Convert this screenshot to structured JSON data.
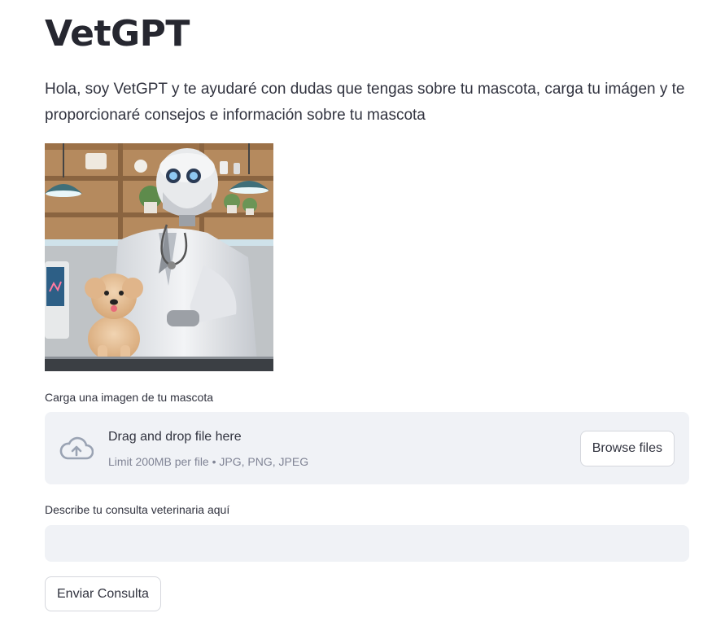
{
  "app": {
    "title": "VetGPT",
    "intro": "Hola, soy VetGPT y te ayudaré con dudas que tengas sobre tu mascota, carga tu imágen y te proporcionaré consejos e información sobre tu mascota"
  },
  "hero_image": {
    "subject": "robot veterinarian with stethoscope petting a small fluffy dog in a clinic"
  },
  "uploader": {
    "label": "Carga una imagen de tu mascota",
    "drop_text": "Drag and drop file here",
    "limit_text": "Limit 200MB per file • JPG, PNG, JPEG",
    "browse_label": "Browse files",
    "icon": "cloud-upload-icon"
  },
  "query": {
    "label": "Describe tu consulta veterinaria aquí",
    "value": "",
    "placeholder": ""
  },
  "submit": {
    "label": "Enviar Consulta"
  },
  "colors": {
    "text": "#31333f",
    "title": "#262730",
    "input_bg": "#f0f2f6",
    "muted": "#808495",
    "border": "#d5d7dd"
  }
}
